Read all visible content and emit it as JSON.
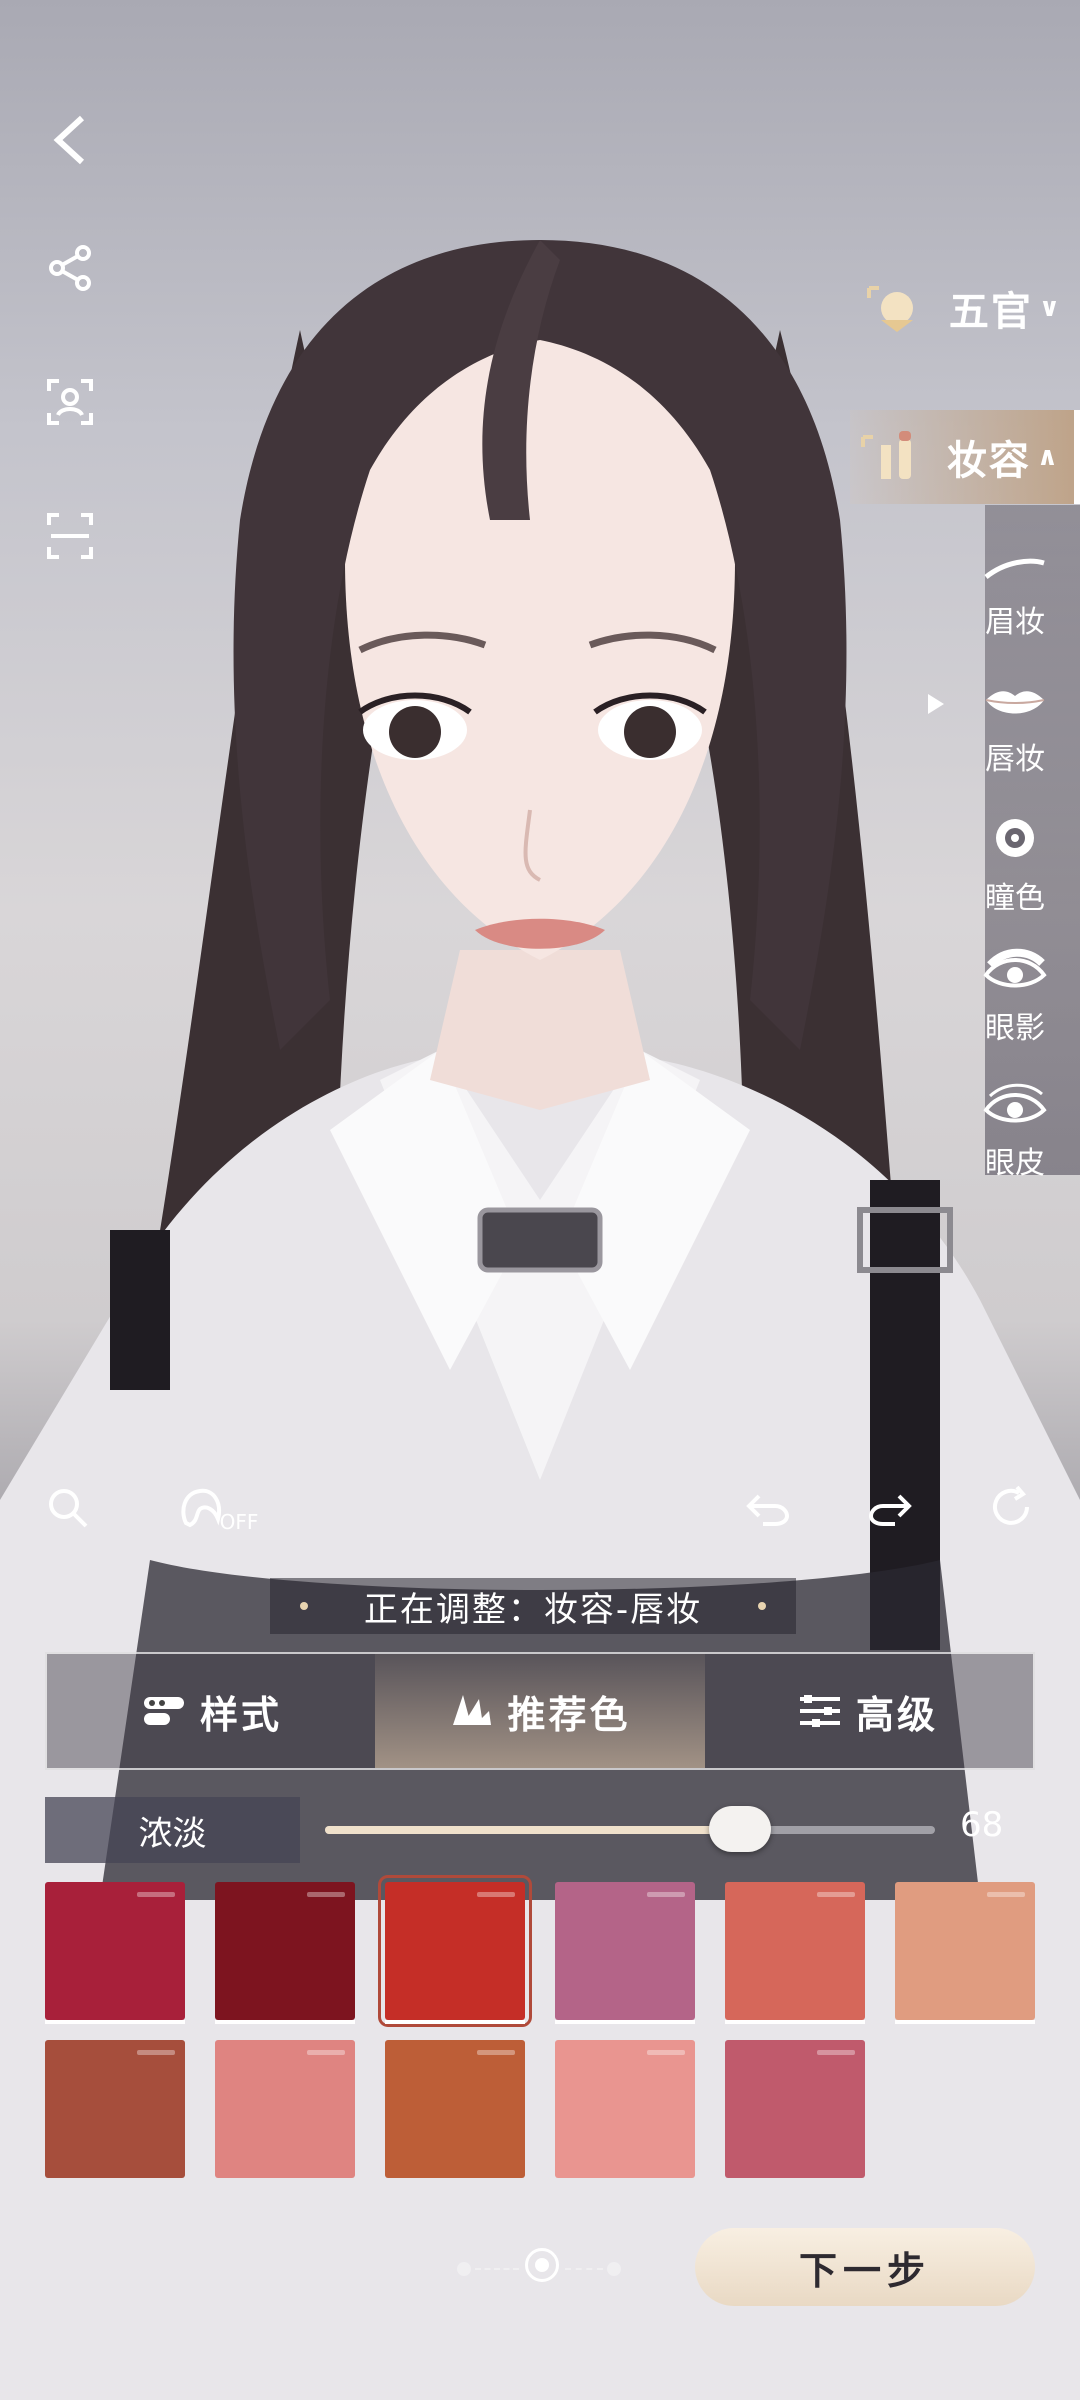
{
  "sidebar_left": {
    "icons": [
      "back-icon",
      "share-icon",
      "face-scan-icon",
      "screenshot-icon"
    ]
  },
  "categories": {
    "facial": {
      "label": "五官",
      "arrow": "∨"
    },
    "makeup": {
      "label": "妆容",
      "arrow": "∧"
    }
  },
  "makeup_items": [
    {
      "label": "眉妆",
      "icon": "eyebrow-icon"
    },
    {
      "label": "唇妆",
      "icon": "lips-icon",
      "selected": true
    },
    {
      "label": "瞳色",
      "icon": "pupil-icon"
    },
    {
      "label": "眼影",
      "icon": "eyeshadow-icon"
    },
    {
      "label": "眼皮",
      "icon": "eyelid-icon"
    }
  ],
  "toolbar": {
    "hair_toggle_state": "OFF"
  },
  "status": {
    "text": "正在调整：妆容-唇妆"
  },
  "tabs": [
    {
      "label": "样式",
      "icon": "style-icon"
    },
    {
      "label": "推荐色",
      "icon": "palette-icon",
      "active": true
    },
    {
      "label": "高级",
      "icon": "settings-sliders-icon"
    }
  ],
  "intensity": {
    "label": "浓淡",
    "value": "68",
    "fraction": 0.68
  },
  "swatches": [
    {
      "color": "#a8203a"
    },
    {
      "color": "#7d141f"
    },
    {
      "color": "#c52e27",
      "selected": true
    },
    {
      "color": "#b46488"
    },
    {
      "color": "#d6675a"
    },
    {
      "color": "#e09c80"
    },
    {
      "color": "#a64e3c"
    },
    {
      "color": "#df8481"
    },
    {
      "color": "#bd5e37"
    },
    {
      "color": "#e99590"
    },
    {
      "color": "#c05a6c"
    }
  ],
  "pagination": {
    "pages": 3,
    "current": 2
  },
  "next_button": {
    "label": "下一步"
  },
  "colors": {
    "accent": "#e9d9c4",
    "selected_outline": "#b04a3a"
  }
}
